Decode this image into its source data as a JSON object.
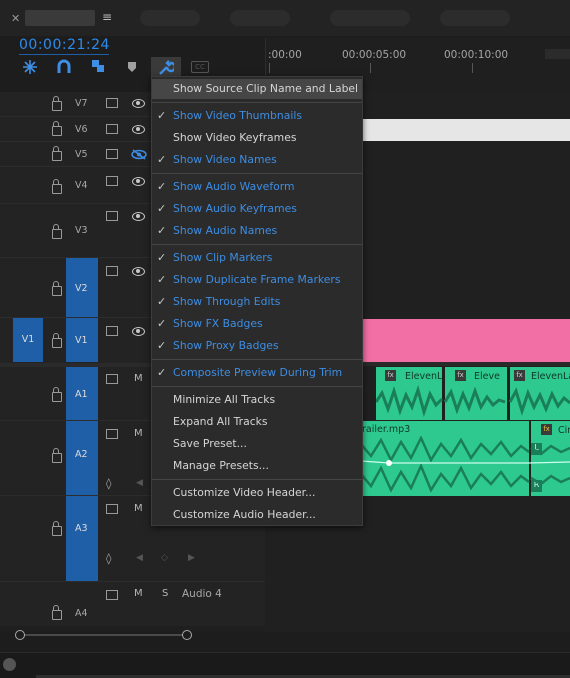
{
  "timeline": {
    "timecode": "00:00:21:24",
    "ruler": [
      ":00:00",
      "00:00:05:00",
      "00:00:10:00"
    ]
  },
  "tracks": {
    "video": [
      {
        "label": "V7"
      },
      {
        "label": "V6"
      },
      {
        "label": "V5"
      },
      {
        "label": "V4"
      },
      {
        "label": "V3"
      },
      {
        "label": "V2"
      },
      {
        "label": "V1",
        "source": "V1"
      }
    ],
    "audio": [
      {
        "label": "A1",
        "m": "M"
      },
      {
        "label": "A2",
        "m": "M"
      },
      {
        "label": "A3",
        "m": "M"
      },
      {
        "label": "A4",
        "m": "M",
        "s": "S",
        "name": "Audio 4"
      }
    ]
  },
  "clips": {
    "a1_1": "ElevenL",
    "a1_2": "Eleve",
    "a1_3": "ElevenLa",
    "a2_name": "railer.mp3",
    "a2_2": "Cin",
    "fx": "fx",
    "left": "L",
    "right": "R"
  },
  "menu": {
    "items": [
      {
        "label": "Show Source Clip Name and Label",
        "checked": false
      },
      {
        "label": "Show Video Thumbnails",
        "checked": true
      },
      {
        "label": "Show Video Keyframes",
        "checked": false
      },
      {
        "label": "Show Video Names",
        "checked": true
      },
      {
        "label": "Show Audio Waveform",
        "checked": true
      },
      {
        "label": "Show Audio Keyframes",
        "checked": true
      },
      {
        "label": "Show Audio Names",
        "checked": true
      },
      {
        "label": "Show Clip Markers",
        "checked": true
      },
      {
        "label": "Show Duplicate Frame Markers",
        "checked": true
      },
      {
        "label": "Show Through Edits",
        "checked": true
      },
      {
        "label": "Show FX Badges",
        "checked": true
      },
      {
        "label": "Show Proxy Badges",
        "checked": true
      },
      {
        "label": "Composite Preview During Trim",
        "checked": true
      },
      {
        "label": "Minimize All Tracks",
        "checked": false
      },
      {
        "label": "Expand All Tracks",
        "checked": false
      },
      {
        "label": "Save Preset...",
        "checked": false
      },
      {
        "label": "Manage Presets...",
        "checked": false
      },
      {
        "label": "Customize Video Header...",
        "checked": false
      },
      {
        "label": "Customize Audio Header...",
        "checked": false
      }
    ],
    "checkmark": "✓"
  },
  "colors": {
    "accent": "#2d8ceb",
    "pink": "#f26fa5",
    "audio": "#2ec98f",
    "target": "#1f5fa8"
  }
}
